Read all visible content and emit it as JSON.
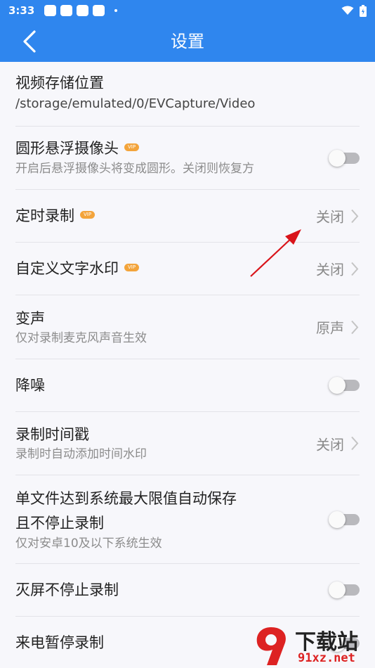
{
  "status_bar": {
    "time": "3:33"
  },
  "app_bar": {
    "title": "设置"
  },
  "vip_badge": "VIP",
  "settings": [
    {
      "title": "视频存储位置",
      "path": "/storage/emulated/0/EVCapture/Video"
    },
    {
      "title": "圆形悬浮摄像头",
      "vip": true,
      "subtitle": "开启后悬浮摄像头将变成圆形。关闭则恢复方",
      "control": "toggle",
      "on": false
    },
    {
      "title": "定时录制",
      "vip": true,
      "value": "关闭",
      "control": "chevron"
    },
    {
      "title": "自定义文字水印",
      "vip": true,
      "value": "关闭",
      "control": "chevron"
    },
    {
      "title": "变声",
      "subtitle": "仅对录制麦克风声音生效",
      "value": "原声",
      "control": "chevron"
    },
    {
      "title": "降噪",
      "control": "toggle",
      "on": false
    },
    {
      "title": "录制时间戳",
      "subtitle": "录制时自动添加时间水印",
      "value": "关闭",
      "control": "chevron"
    },
    {
      "title": "单文件达到系统最大限值自动保存",
      "title2": "且不停止录制",
      "subtitle": "仅对安卓10及以下系统生效",
      "control": "toggle",
      "on": false
    },
    {
      "title": "灭屏不停止录制",
      "control": "toggle",
      "on": false
    },
    {
      "title": "来电暂停录制",
      "control": "toggle",
      "on": false
    }
  ],
  "watermark": {
    "brand": "下载站",
    "url": "91xz.net"
  },
  "colors": {
    "primary": "#2f86ee",
    "vip": "#f3a43b",
    "annotation_arrow": "#d9141a"
  }
}
